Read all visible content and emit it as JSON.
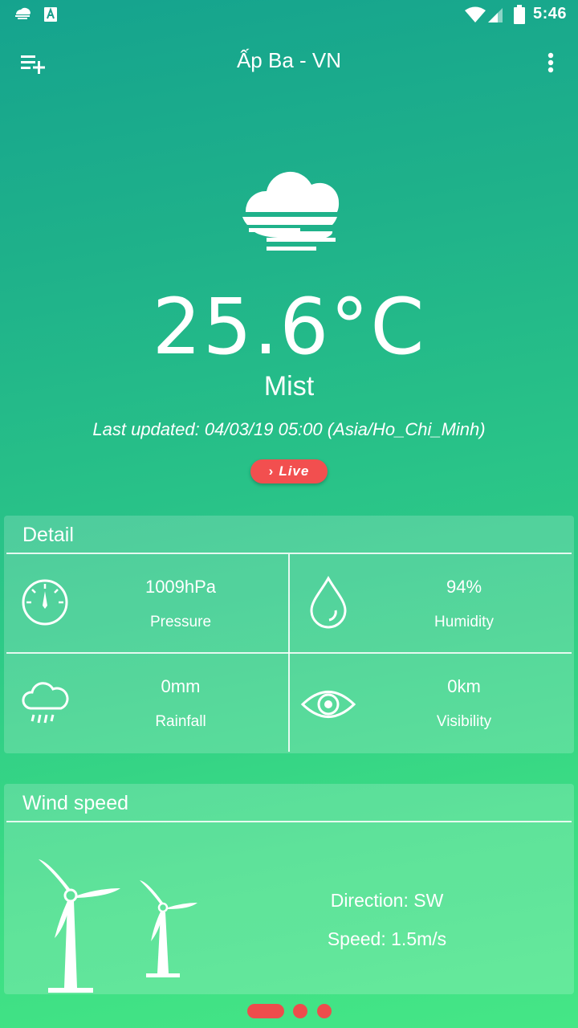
{
  "status_bar": {
    "time": "5:46",
    "icons": [
      "weather-cloud-icon",
      "text-a-icon",
      "wifi-icon",
      "signal-icon",
      "battery-icon"
    ]
  },
  "toolbar": {
    "title": "Ấp Ba - VN",
    "left_icon": "playlist-add-icon",
    "right_icon": "more-vertical-icon"
  },
  "current": {
    "icon": "mist-icon",
    "temperature": "25.6°C",
    "condition": "Mist",
    "last_updated": "Last updated: 04/03/19 05:00 (Asia/Ho_Chi_Minh)",
    "live_label": "Live"
  },
  "detail": {
    "title": "Detail",
    "items": [
      {
        "icon": "pressure-gauge-icon",
        "value": "1009hPa",
        "label": "Pressure"
      },
      {
        "icon": "humidity-drop-icon",
        "value": "94%",
        "label": "Humidity"
      },
      {
        "icon": "rain-cloud-icon",
        "value": "0mm",
        "label": "Rainfall"
      },
      {
        "icon": "eye-icon",
        "value": "0km",
        "label": "Visibility"
      }
    ]
  },
  "wind": {
    "title": "Wind speed",
    "direction": "Direction: SW",
    "speed": "Speed: 1.5m/s"
  },
  "pager": {
    "page_count": 3,
    "active_index": 0
  },
  "colors": {
    "accent_red": "#f24f4f",
    "gradient_top": "#15a38e",
    "gradient_bottom": "#45e686"
  }
}
